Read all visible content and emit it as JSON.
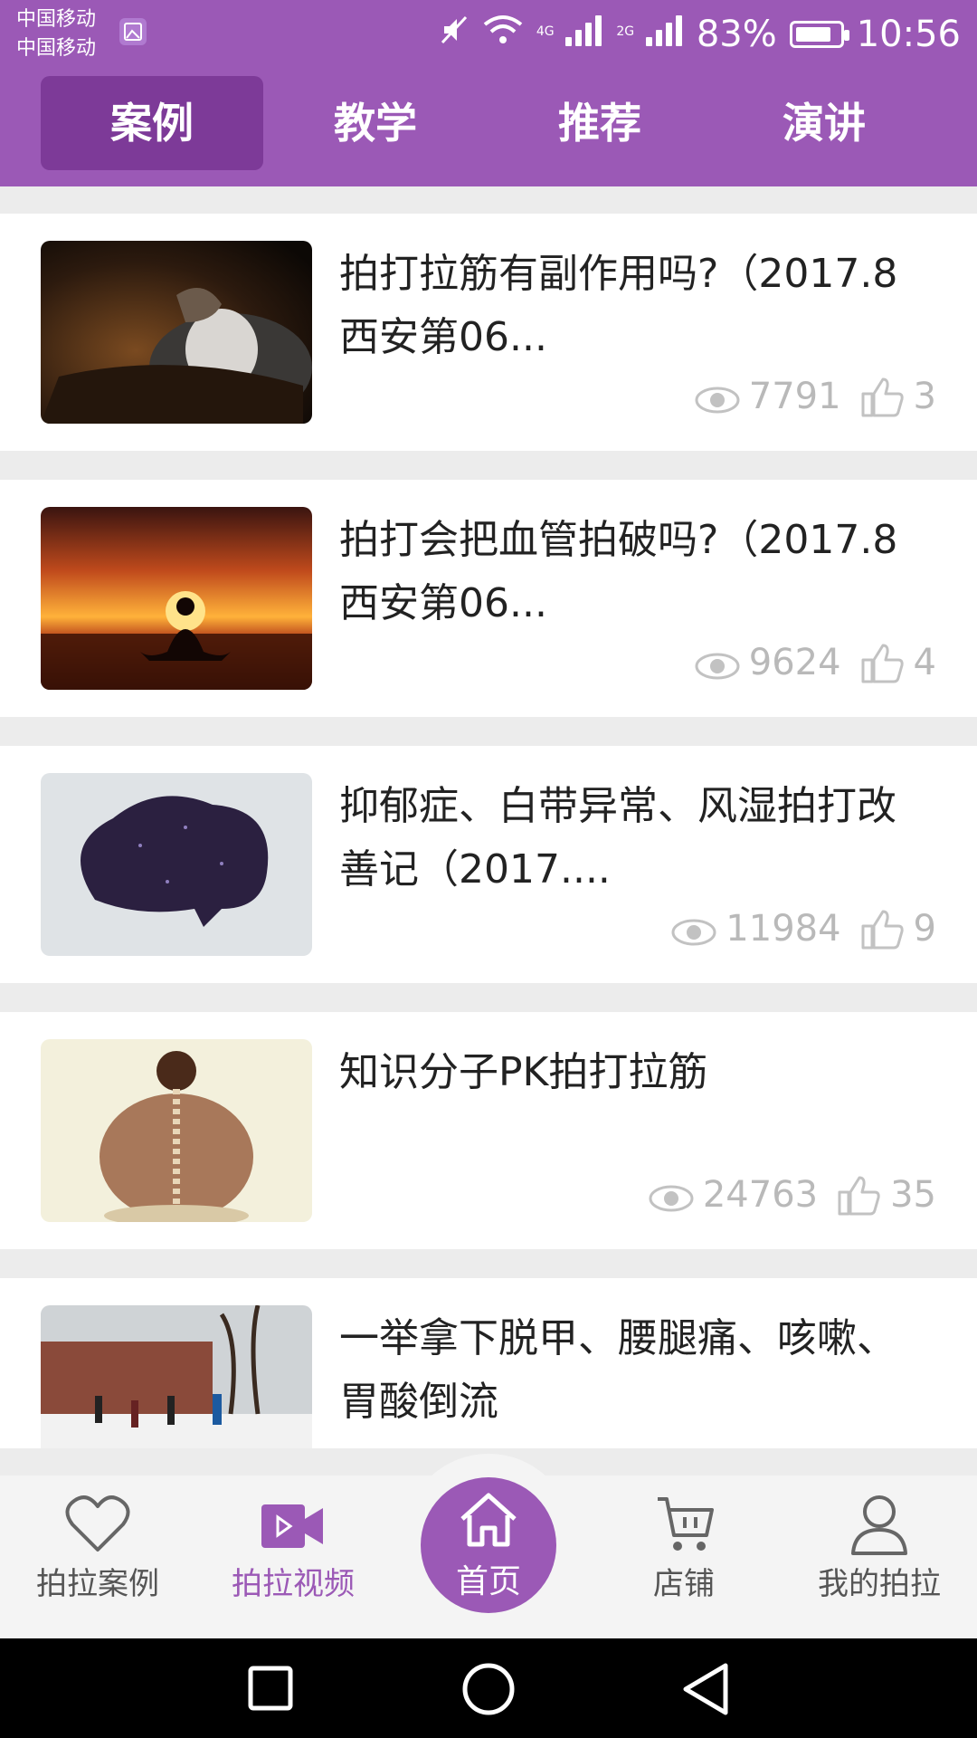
{
  "status_bar": {
    "carrier_1": "中国移动",
    "carrier_2": "中国移动",
    "network_1": "4G",
    "network_2": "2G",
    "battery": "83%",
    "battery_level": 0.83,
    "time": "10:56"
  },
  "tabs": [
    {
      "label": "案例",
      "active": true
    },
    {
      "label": "教学",
      "active": false
    },
    {
      "label": "推荐",
      "active": false
    },
    {
      "label": "演讲",
      "active": false
    }
  ],
  "articles": [
    {
      "title": "拍打拉筋有副作用吗?（2017.8西安第06...",
      "views": "7791",
      "likes": "3",
      "thumb": "meditation-dark"
    },
    {
      "title": "拍打会把血管拍破吗?（2017.8西安第06...",
      "views": "9624",
      "likes": "4",
      "thumb": "sunset-meditation"
    },
    {
      "title": "抑郁症、白带异常、风湿拍打改善记（2017....",
      "views": "11984",
      "likes": "9",
      "thumb": "brain"
    },
    {
      "title": "知识分子PK拍打拉筋",
      "views": "24763",
      "likes": "35",
      "thumb": "spine-back"
    },
    {
      "title": "一举拿下脱甲、腰腿痛、咳嗽、胃酸倒流",
      "views": "",
      "likes": "",
      "thumb": "snow-group"
    }
  ],
  "bottom_nav": [
    {
      "label": "拍拉案例",
      "icon": "heart-icon",
      "active": false
    },
    {
      "label": "拍拉视频",
      "icon": "video-icon",
      "active": true
    },
    {
      "label": "首页",
      "icon": "home-icon",
      "active": false
    },
    {
      "label": "店铺",
      "icon": "cart-icon",
      "active": false
    },
    {
      "label": "我的拍拉",
      "icon": "user-icon",
      "active": false
    }
  ],
  "colors": {
    "primary": "#9b59b6",
    "tab_active": "#7d3a98",
    "muted": "#b9b9b9"
  }
}
